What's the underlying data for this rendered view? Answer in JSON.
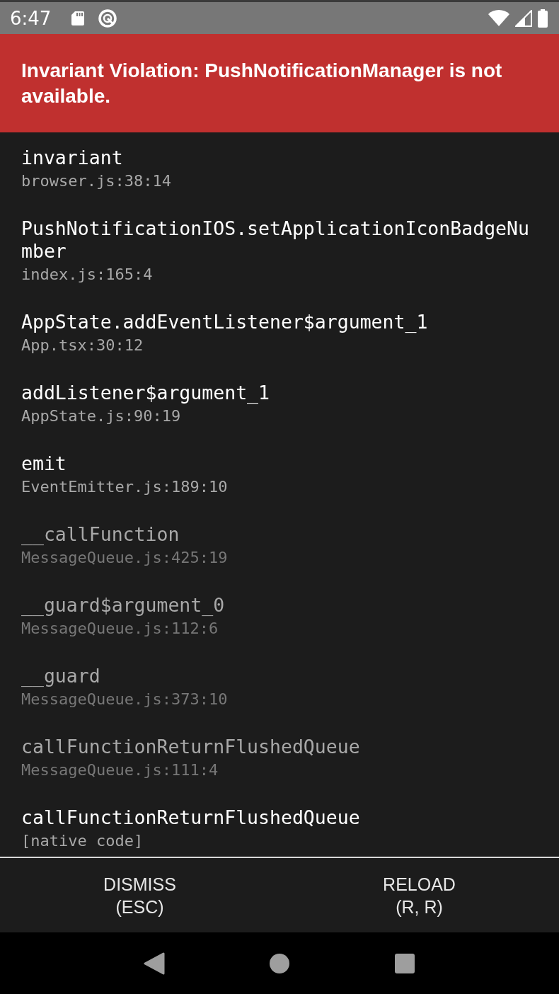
{
  "status_bar": {
    "time": "6:47"
  },
  "error": {
    "message": "Invariant Violation: PushNotificationManager is not available."
  },
  "frames": [
    {
      "method": "invariant",
      "location": "browser.js:38:14",
      "dimmed": false
    },
    {
      "method": "PushNotificationIOS.setApplicationIconBadgeNumber",
      "location": "index.js:165:4",
      "dimmed": false
    },
    {
      "method": "AppState.addEventListener$argument_1",
      "location": "App.tsx:30:12",
      "dimmed": false
    },
    {
      "method": "addListener$argument_1",
      "location": "AppState.js:90:19",
      "dimmed": false
    },
    {
      "method": "emit",
      "location": "EventEmitter.js:189:10",
      "dimmed": false
    },
    {
      "method": "__callFunction",
      "location": "MessageQueue.js:425:19",
      "dimmed": true
    },
    {
      "method": "__guard$argument_0",
      "location": "MessageQueue.js:112:6",
      "dimmed": true
    },
    {
      "method": "__guard",
      "location": "MessageQueue.js:373:10",
      "dimmed": true
    },
    {
      "method": "callFunctionReturnFlushedQueue",
      "location": "MessageQueue.js:111:4",
      "dimmed": true
    },
    {
      "method": "callFunctionReturnFlushedQueue",
      "location": "[native code]",
      "dimmed": false
    }
  ],
  "buttons": [
    {
      "label": "DISMISS",
      "shortcut": "(ESC)"
    },
    {
      "label": "RELOAD",
      "shortcut": "(R, R)"
    }
  ]
}
